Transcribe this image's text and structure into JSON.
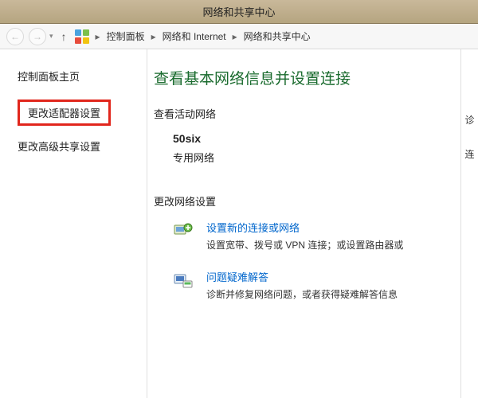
{
  "window": {
    "title": "网络和共享中心"
  },
  "breadcrumb": {
    "items": [
      "控制面板",
      "网络和 Internet",
      "网络和共享中心"
    ]
  },
  "sidebar": {
    "home": "控制面板主页",
    "adapter": "更改适配器设置",
    "advanced": "更改高级共享设置"
  },
  "main": {
    "heading": "查看基本网络信息并设置连接",
    "active_networks_label": "查看活动网络",
    "network": {
      "name": "50six",
      "type": "专用网络"
    },
    "change_settings_label": "更改网络设置",
    "items": [
      {
        "icon": "new-connection-icon",
        "link": "设置新的连接或网络",
        "desc": "设置宽带、拨号或 VPN 连接；或设置路由器或"
      },
      {
        "icon": "troubleshoot-icon",
        "link": "问题疑难解答",
        "desc": "诊断并修复网络问题，或者获得疑难解答信息"
      }
    ]
  },
  "right": {
    "a": "诊",
    "b": "连"
  }
}
